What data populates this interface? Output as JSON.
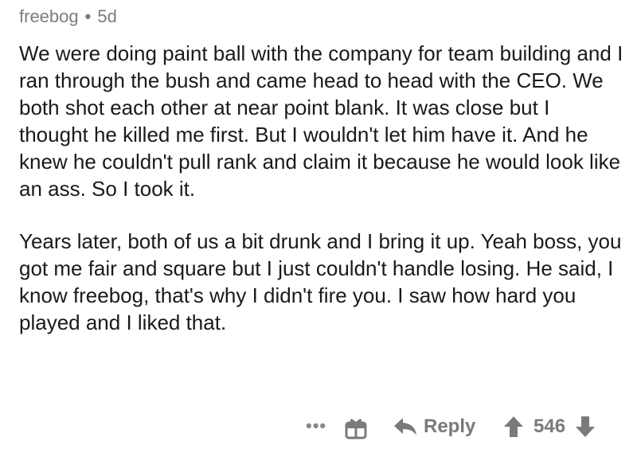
{
  "comment": {
    "author": "freebog",
    "age": "5d",
    "paragraphs": [
      "We were doing paint ball with the company for team building and I ran through the bush and came head to head with the CEO. We both shot each other at near point blank. It was close but I thought he killed me first. But I wouldn't let him have it. And he knew he couldn't pull rank and claim it because he would look like an ass. So I took it.",
      "Years later, both of us a bit drunk and I bring it up. Yeah boss, you got me fair and square but I just couldn't handle losing. He said, I know freebog, that's why I didn't fire you. I saw how hard you played and I liked that."
    ]
  },
  "actions": {
    "more_label": "•••",
    "reply_label": "Reply",
    "score": "546"
  },
  "icons": {
    "more": "more-options-icon",
    "award": "gift-award-icon",
    "reply": "reply-arrow-icon",
    "upvote": "upvote-arrow-icon",
    "downvote": "downvote-arrow-icon"
  },
  "colors": {
    "text": "#1a1a1b",
    "meta": "#7c7c7c",
    "icon": "#7a7a7a"
  }
}
